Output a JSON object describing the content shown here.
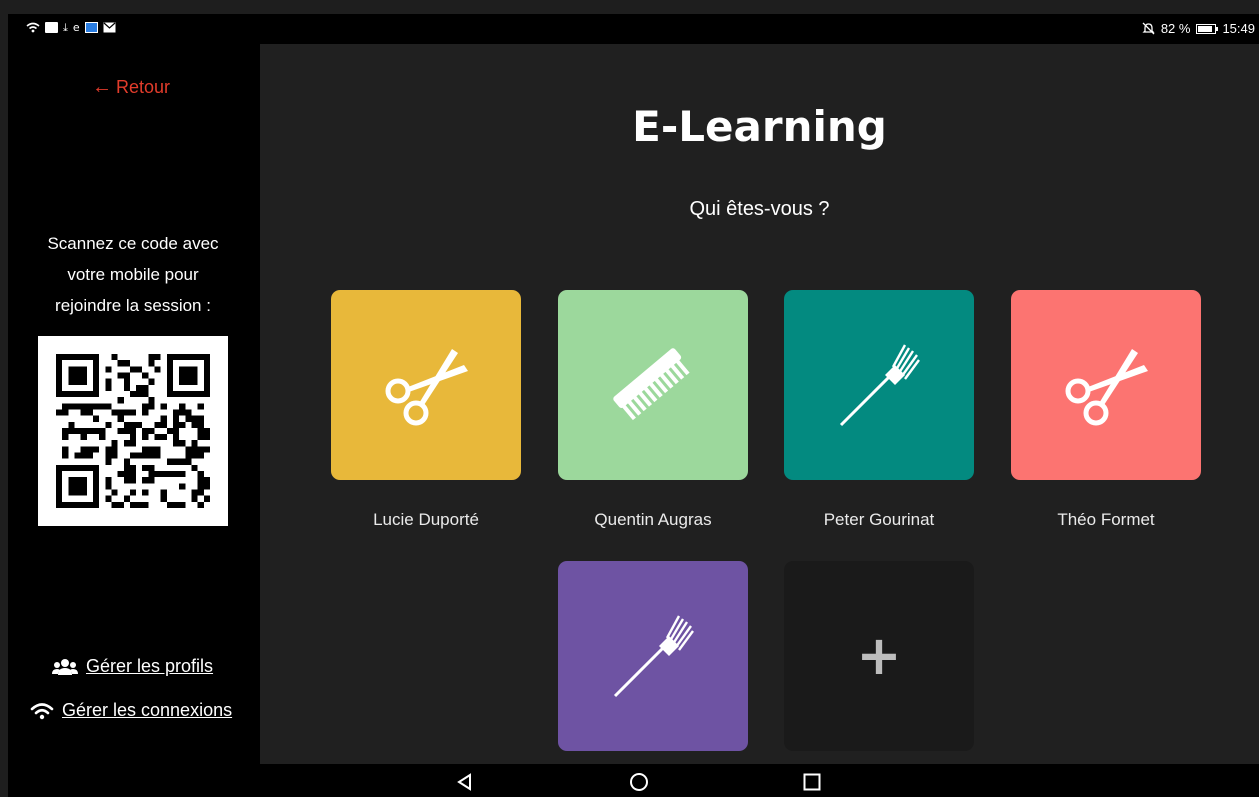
{
  "status_bar": {
    "battery_percent": "82 %",
    "battery_level": 0.82,
    "time": "15:49",
    "icons": [
      "wifi-icon",
      "photo-icon",
      "download-icon",
      "e-icon",
      "app-icon",
      "mail-icon",
      "mute-icon",
      "battery-icon"
    ]
  },
  "sidebar": {
    "back_label": "Retour",
    "scan_text_line1": "Scannez ce code avec",
    "scan_text_line2": "votre mobile pour",
    "scan_text_line3": "rejoindre la session :",
    "manage_profiles": "Gérer les profils",
    "manage_connections": "Gérer les connexions"
  },
  "main": {
    "title": "E-Learning",
    "subtitle": "Qui êtes-vous ?",
    "profiles": [
      {
        "name": "Lucie Duporté",
        "color": "#e8b83a",
        "icon": "scissors-icon"
      },
      {
        "name": "Quentin Augras",
        "color": "#9cd89c",
        "icon": "comb-icon"
      },
      {
        "name": "Peter Gourinat",
        "color": "#038a80",
        "icon": "tint-brush-icon"
      },
      {
        "name": "Théo Formet",
        "color": "#fc7471",
        "icon": "scissors-icon"
      },
      {
        "name": "",
        "color": "#6e53a3",
        "icon": "tint-brush-icon"
      }
    ],
    "add_tile_color": "#1a1a1a",
    "add_icon": "plus-icon"
  },
  "colors": {
    "accent_back": "#e23c2b",
    "main_bg": "#202020",
    "sidebar_bg": "#000000"
  }
}
